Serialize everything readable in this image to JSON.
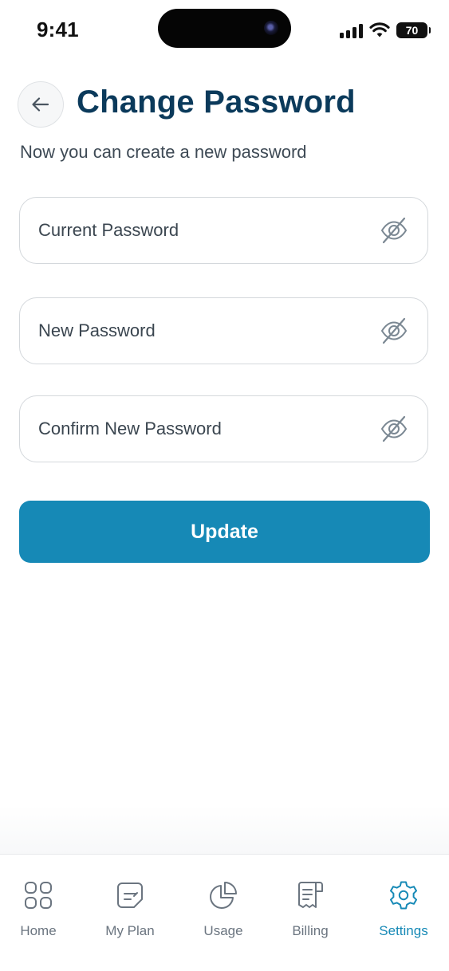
{
  "status_bar": {
    "time": "9:41",
    "battery": "70"
  },
  "header": {
    "title": "Change Password",
    "subtitle": "Now you can create a new password"
  },
  "form": {
    "fields": [
      {
        "placeholder": "Current Password",
        "value": ""
      },
      {
        "placeholder": "New Password",
        "value": ""
      },
      {
        "placeholder": "Confirm New Password",
        "value": ""
      }
    ],
    "submit_label": "Update"
  },
  "tab_bar": {
    "items": [
      {
        "label": "Home",
        "icon": "grid-icon",
        "active": false
      },
      {
        "label": "My Plan",
        "icon": "document-icon",
        "active": false
      },
      {
        "label": "Usage",
        "icon": "pie-chart-icon",
        "active": false
      },
      {
        "label": "Billing",
        "icon": "receipt-icon",
        "active": false
      },
      {
        "label": "Settings",
        "icon": "gear-icon",
        "active": true
      }
    ]
  },
  "colors": {
    "title": "#0b3a5b",
    "accent": "#1689b6",
    "tab_inactive": "#6b7580",
    "field_border": "#d4d8dc"
  }
}
